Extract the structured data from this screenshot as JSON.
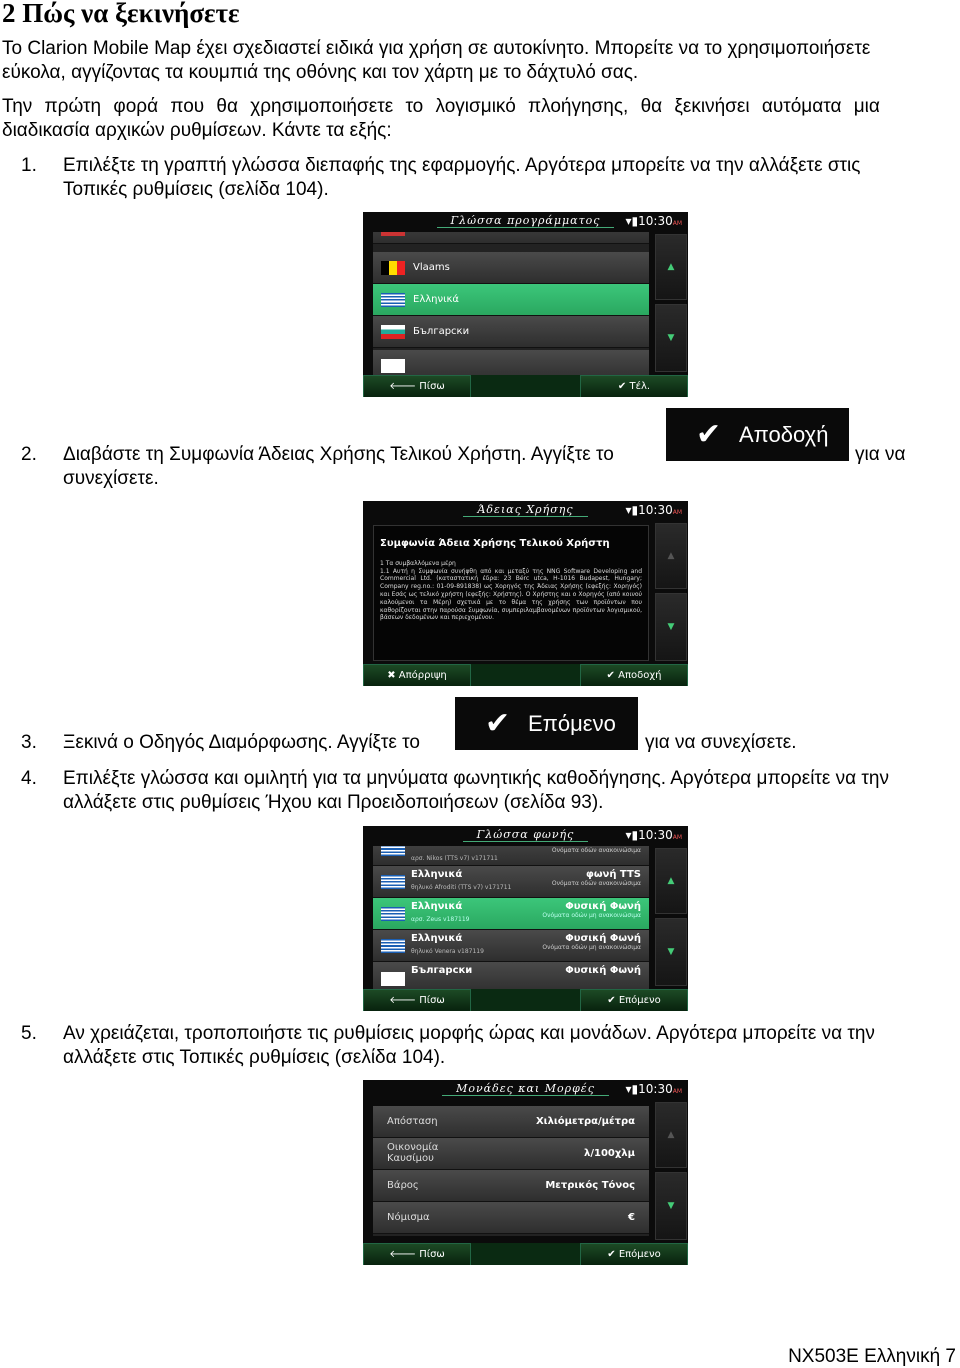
{
  "title": "2 Πώς να ξεκινήσετε",
  "paragraphs": [
    [
      "Το Clarion Mobile Map έχει σχεδιαστεί ειδικά για χρήση σε αυτοκίνητο. Μπορείτε να το χρησιμοποιήσετε",
      "εύκολα, αγγίζοντας τα κουμπιά της οθόνης και τον χάρτη με το δάχτυλό σας."
    ],
    [
      "Την πρώτη φορά που θα χρησιμοποιήσετε το λογισμικό πλοήγησης, θα ξεκινήσει αυτόματα μια",
      "διαδικασία αρχικών ρυθμίσεων. Κάντε τα εξής:"
    ]
  ],
  "steps": [
    {
      "num": "1.",
      "lines": [
        "Επιλέξτε τη γραπτή γλώσσα διεπαφής της εφαρμογής. Αργότερα μπορείτε να την αλλάξετε στις",
        "Τοπικές ρυθμίσεις (σελίδα 104)."
      ]
    },
    {
      "num": "2.",
      "before": "Διαβάστε τη Συμφωνία Άδειας Χρήσης Τελικού Χρήστη. Αγγίξτε το",
      "button": "Αποδοχή",
      "after": "για να",
      "line2": "συνεχίσετε."
    },
    {
      "num": "3.",
      "before": "Ξεκινά ο Οδηγός Διαμόρφωσης. Αγγίξτε το",
      "button": "Επόμενο",
      "after": "για να συνεχίσετε."
    },
    {
      "num": "4.",
      "lines": [
        "Επιλέξτε γλώσσα και ομιλητή για τα μηνύματα φωνητικής καθοδήγησης. Αργότερα μπορείτε να την",
        "αλλάξετε στις ρυθμίσεις Ήχου και Προειδοποιήσεων (σελίδα 93)."
      ]
    },
    {
      "num": "5.",
      "lines": [
        "Αν χρειάζεται, τροποποιήστε τις ρυθμίσεις μορφής ώρας και μονάδων. Αργότερα μπορείτε να την",
        "αλλάξετε στις Τοπικές ρυθμίσεις (σελίδα 104)."
      ]
    }
  ],
  "clock": "10:30",
  "ampm": "AM",
  "screen1": {
    "title": "Γλώσσα προγράμματος",
    "items": [
      "Vlaams",
      "Ελληνικά",
      "Български"
    ],
    "selected": "Ελληνικά",
    "back": "Πίσω",
    "done": "Τέλ."
  },
  "screen2": {
    "title": "Άδειας Χρήσης",
    "heading": "Συμφωνία Άδεια Χρήσης Τελικού Χρήστη",
    "section": "1 Τα συμβαλλόμενα μέρη",
    "body": "1.1 Αυτή η Συμφωνία συνήφθη από και μεταξύ της NNG Software Developing and Commercial Ltd. (καταστατική έδρα: 23 Bérc utca, H-1016 Budapest, Hungary; Company reg.no.: 01-09-891838) ως Χορηγός της Άδειας Χρήσης (εφεξής: Χορηγός) και Εσάς ως τελικό χρήστη (εφεξής: Χρήστης). Ο Χρήστης και ο Χορηγός (από κοινού καλούμενοι τα Μέρη) σχετικά με το θέμα της χρήσης των προϊόντων που καθορίζονται στην παρούσα Συμφωνία, συμπεριλαμβανομένων προϊόντων λογισμικού, βάσεων δεδομένων και περιεχομένου.",
    "reject": "Απόρριψη",
    "accept": "Αποδοχή"
  },
  "screen3": {
    "title": "Γλώσσα φωνής",
    "rows": [
      {
        "lang": "",
        "voice": "αρσ. Nikos (TTS v7) v171711",
        "type": "",
        "note": "Ονόματα οδών ανακοινώσιμα"
      },
      {
        "lang": "Ελληνικά",
        "voice": "θηλυκό Afroditi (TTS v7) v171711",
        "type": "φωνή TTS",
        "note": "Ονόματα οδών ανακοινώσιμα"
      },
      {
        "lang": "Ελληνικά",
        "voice": "αρσ. Zeus v187119",
        "type": "Φυσική Φωνή",
        "note": "Ονόματα οδών μη ανακοινώσιμα"
      },
      {
        "lang": "Ελληνικά",
        "voice": "θηλυκό Venera v187119",
        "type": "Φυσική Φωνή",
        "note": "Ονόματα οδών μη ανακοινώσιμα"
      },
      {
        "lang": "Български",
        "voice": "",
        "type": "Φυσική Φωνή",
        "note": ""
      }
    ],
    "back": "Πίσω",
    "next": "Επόμενο"
  },
  "screen4": {
    "title": "Μονάδες και Μορφές",
    "rows": [
      {
        "label": "Απόσταση",
        "value": "Χιλιόμετρα/μέτρα"
      },
      {
        "label": "Οικονομία Καυσίμου",
        "value": "λ/100χλμ"
      },
      {
        "label": "Βάρος",
        "value": "Μετρικός Τόνος"
      },
      {
        "label": "Νόμισμα",
        "value": "€"
      }
    ],
    "back": "Πίσω",
    "next": "Επόμενο"
  },
  "footer": "NX503E Ελληνική 7",
  "colors": {
    "highlight": "#35bd72",
    "screen_bg": "#0b0b0b",
    "button_bar": "#0a2a12"
  }
}
